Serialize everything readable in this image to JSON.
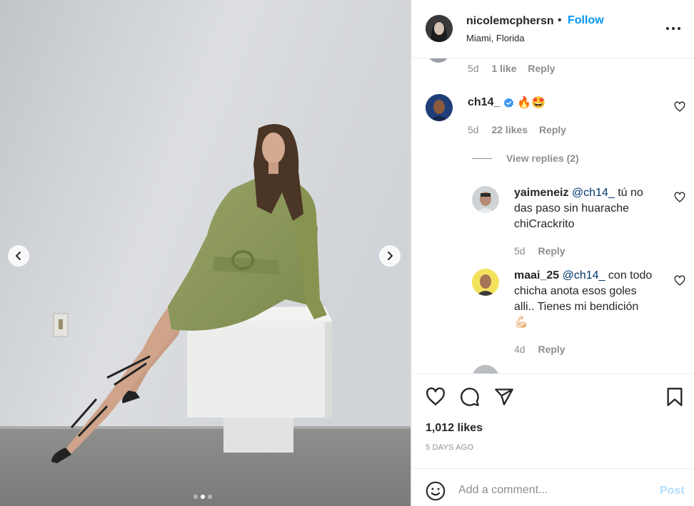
{
  "post": {
    "author": "nicolemcphersn",
    "separator": "•",
    "follow_label": "Follow",
    "location": "Miami, Florida",
    "carousel": {
      "slide_count": 3,
      "active_index": 1
    }
  },
  "comments": {
    "top_partial": {
      "age": "5d",
      "likes": "1 like",
      "reply_label": "Reply"
    },
    "main": {
      "username": "ch14_",
      "verified": true,
      "text": "🔥🤩",
      "age": "5d",
      "likes": "22 likes",
      "reply_label": "Reply",
      "view_replies": "View replies (2)"
    },
    "replies": [
      {
        "username": "yaimeneiz",
        "mention": "@ch14_",
        "text_lines": [
          "tú no",
          "das paso sin huarache",
          "chiCrackrito"
        ],
        "age": "5d",
        "reply_label": "Reply"
      },
      {
        "username": "maai_25",
        "mention": "@ch14_",
        "text_lines": [
          "con todo",
          "chicha anota esos goles",
          "alli.. Tienes mi bendición",
          "💪🏻"
        ],
        "age": "4d",
        "reply_label": "Reply"
      }
    ]
  },
  "stats": {
    "likes": "1,012 likes",
    "posted": "5 DAYS AGO"
  },
  "add_comment": {
    "placeholder": "Add a comment...",
    "post_label": "Post"
  },
  "icons": {
    "more": "more-horizontal-icon",
    "like": "heart-icon",
    "comment": "comment-icon",
    "share": "send-icon",
    "save": "bookmark-icon",
    "emoji": "emoji-icon",
    "verified": "verified-badge-icon"
  },
  "colors": {
    "link": "#0095f6",
    "post_disabled": "#b2dffc",
    "muted": "#8e8e8e",
    "mention": "#00376b",
    "verified": "#3897f0"
  }
}
